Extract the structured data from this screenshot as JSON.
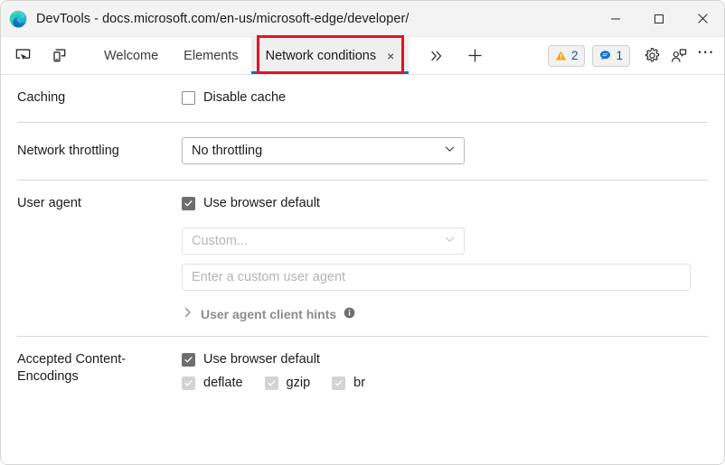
{
  "window": {
    "title": "DevTools - docs.microsoft.com/en-us/microsoft-edge/developer/",
    "logo_icon": "edge-logo-icon",
    "controls": {
      "minimize": "minimize-icon",
      "maximize": "maximize-icon",
      "close": "close-icon"
    }
  },
  "toolbar": {
    "inspect_icon": "inspect-element-icon",
    "device_icon": "device-emulation-icon",
    "more_tabs_icon": "chevron-double-right-icon",
    "add_tab_icon": "plus-icon",
    "tabs": [
      {
        "label": "Welcome",
        "active": false,
        "closable": false
      },
      {
        "label": "Elements",
        "active": false,
        "closable": false
      },
      {
        "label": "Network conditions",
        "active": true,
        "closable": true,
        "close_label": "×"
      }
    ],
    "warnings": {
      "icon": "warning-triangle-icon",
      "count": "2"
    },
    "messages": {
      "icon": "message-bubble-icon",
      "count": "1"
    },
    "settings_icon": "gear-icon",
    "feedback_icon": "feedback-icon",
    "more_icon": "more-options-icon",
    "more_glyph": "⋯"
  },
  "panel": {
    "caching": {
      "label": "Caching",
      "disable_cache": {
        "label": "Disable cache",
        "checked": false
      }
    },
    "throttling": {
      "label": "Network throttling",
      "value": "No throttling",
      "caret_icon": "chevron-down-icon"
    },
    "user_agent": {
      "label": "User agent",
      "use_browser_default": {
        "label": "Use browser default",
        "checked": true
      },
      "custom_select": {
        "value": "Custom...",
        "disabled": true,
        "caret_icon": "chevron-down-icon"
      },
      "custom_input": {
        "placeholder": "Enter a custom user agent",
        "value": ""
      },
      "client_hints": {
        "label": "User agent client hints",
        "expand_icon": "chevron-right-icon",
        "info_icon": "info-icon"
      }
    },
    "encodings": {
      "label": "Accepted Content-Encodings",
      "use_browser_default": {
        "label": "Use browser default",
        "checked": true
      },
      "options": [
        {
          "label": "deflate",
          "checked": true,
          "disabled": true
        },
        {
          "label": "gzip",
          "checked": true,
          "disabled": true
        },
        {
          "label": "br",
          "checked": true,
          "disabled": true
        }
      ]
    }
  },
  "colors": {
    "accent": "#0d6ebd",
    "highlight_box": "#e81123",
    "warning": "#f6a500",
    "message": "#1073d6"
  }
}
